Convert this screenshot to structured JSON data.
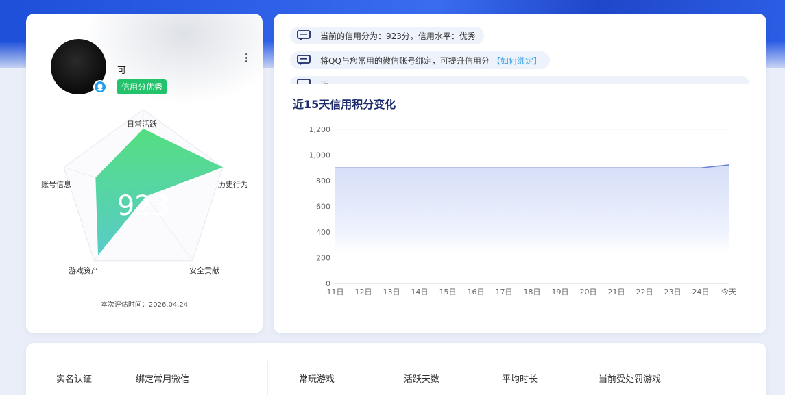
{
  "profile": {
    "username": "可",
    "credit_tag": "信用分优秀",
    "score": "923",
    "eval_time": "本次评估时间：2026.04.24",
    "radar": {
      "axes": [
        "日常活跃",
        "历史行为",
        "安全贡献",
        "游戏资产",
        "账号信息"
      ],
      "values": [
        0.77,
        1.0,
        0.05,
        0.92,
        0.6
      ]
    }
  },
  "notices": {
    "n1": "当前的信用分为：923分，信用水平：优秀",
    "n2": "将QQ与您常用的微信账号绑定，可提升信用分",
    "n2_link": "【如何绑定】",
    "n3": "近…  ……  …  …  …  …"
  },
  "chart_title": "近15天信用积分变化",
  "chart_data": {
    "type": "area",
    "x": [
      "11日",
      "12日",
      "13日",
      "14日",
      "15日",
      "16日",
      "17日",
      "18日",
      "19日",
      "20日",
      "21日",
      "22日",
      "23日",
      "24日",
      "今天"
    ],
    "values": [
      900,
      900,
      900,
      900,
      900,
      900,
      900,
      900,
      900,
      900,
      900,
      900,
      900,
      900,
      923
    ],
    "y_ticks": [
      "0",
      "200",
      "400",
      "600",
      "800",
      "1,000",
      "1,200"
    ],
    "ylim": [
      0,
      1200
    ],
    "line_color": "#6b86d6",
    "fill_color": "#dfe6fa"
  },
  "bottom": {
    "labels": [
      "实名认证",
      "绑定常用微信",
      "常玩游戏",
      "活跃天数",
      "平均时长",
      "当前受处罚游戏"
    ]
  },
  "colors": {
    "radar_fill": "#3ed08f",
    "tag_green": "#22c36a",
    "link_blue": "#3aa3e8",
    "title_navy": "#1c2b6b"
  }
}
